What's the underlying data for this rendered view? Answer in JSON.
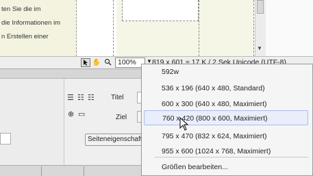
{
  "document": {
    "lines": [
      "ten Sie die im",
      "die Informationen im",
      "n Erstellen einer"
    ]
  },
  "statusbar": {
    "zoom": "100%",
    "size_text": "819 x 601 ≈  17 K / 2 Sek  Unicode (UTF-8)"
  },
  "properties": {
    "title_label": "Titel",
    "target_label": "Ziel",
    "page_props_button": "Seiteneigenschaften..."
  },
  "window_size_menu": {
    "items": [
      {
        "label": "592w"
      },
      {
        "label": "536 x 196   (640 x 480, Standard)"
      },
      {
        "label": "600 x 300   (640 x 480, Maximiert)"
      },
      {
        "label": "760 x 420   (800 x 600, Maximiert)",
        "highlighted": true
      },
      {
        "label": "795 x 470   (832 x 624, Maximiert)"
      },
      {
        "label": "955 x 600   (1024 x 768, Maximiert)"
      }
    ],
    "edit_sizes": "Größen bearbeiten..."
  },
  "icons": [
    "select-arrow-icon",
    "hand-icon",
    "zoom-icon",
    "unordered-list-icon",
    "ordered-list-icon",
    "indent-icon",
    "link-icon",
    "folder-icon",
    "mouse-cursor-icon"
  ]
}
